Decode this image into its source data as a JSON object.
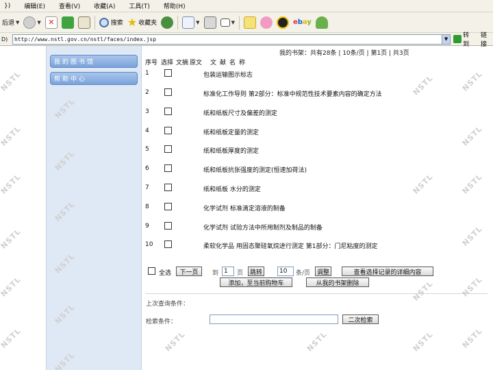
{
  "menu": [
    "})",
    "编辑(E)",
    "查看(V)",
    "收藏(A)",
    "工具(T)",
    "帮助(H)"
  ],
  "toolbar": {
    "back_label": "后退",
    "search_label": "搜索",
    "favorites_label": "收藏夹"
  },
  "address": {
    "label": "D)",
    "value": "http://www.nstl.gov.cn/nstl/faces/index.jsp",
    "go_label": "转到",
    "links_label": "链接"
  },
  "sidebar": {
    "items": [
      {
        "label": "我的图书馆"
      },
      {
        "label": "帮助中心"
      }
    ]
  },
  "pager_top": "我的书架：共有28条 | 10条/页 | 第1页 | 共3页",
  "table": {
    "headers": [
      "序号",
      "选择",
      "文摘",
      "原文",
      "文献名称"
    ],
    "rows": [
      {
        "num": "1",
        "title": "包装运输图示标志"
      },
      {
        "num": "2",
        "title": "标准化工作导则 第2部分：标准中规范性技术要素内容的确定方法"
      },
      {
        "num": "3",
        "title": "纸和纸板尺寸及偏差的测定"
      },
      {
        "num": "4",
        "title": "纸和纸板定量的测定"
      },
      {
        "num": "5",
        "title": "纸和纸板厚度的测定"
      },
      {
        "num": "6",
        "title": "纸和纸板抗张强度的测定(恒速加荷法)"
      },
      {
        "num": "7",
        "title": "纸和纸板 水分的测定"
      },
      {
        "num": "8",
        "title": "化学试剂 标准滴定溶液的制备"
      },
      {
        "num": "9",
        "title": "化学试剂 试验方法中所用制剂及制品的制备"
      },
      {
        "num": "10",
        "title": "柔软化学品 用固态聚硅氧烷进行测定 第1部分：门尼粘度的测定"
      }
    ]
  },
  "controls": {
    "select_all": "全选",
    "next_page": "下一页",
    "goto_prefix": "到",
    "goto_page_value": "1",
    "page_unit": "页",
    "jump": "跳转",
    "per_page_value": "10",
    "per_page_unit": "条/页",
    "adjust": "调整",
    "view_selected": "查看选择记录的详细内容",
    "add_cart": "添加，至当前购物车",
    "remove_shelf": "从我的书架删除"
  },
  "search": {
    "prev_label": "上次查询条件：",
    "retrieve_label": "检索条件：",
    "input_value": "",
    "submit": "二次检索"
  },
  "watermark_text": "NSTL",
  "colors": {
    "chrome": "#f3f1e8",
    "sidebar_bg": "#dfe8f5",
    "sidebar_button": "#7aa2db"
  }
}
